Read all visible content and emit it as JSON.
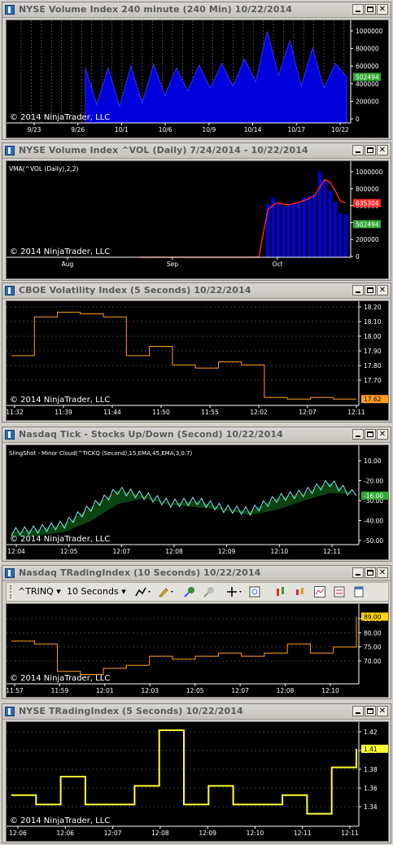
{
  "copyright": "© 2014 NinjaTrader, LLC",
  "colors": {
    "bg": "#000000",
    "grid": "#3a3a3a",
    "axis": "#ffffff",
    "volume": "#0000dd",
    "vma": "#ff2a2a",
    "orange": "#ff9e1f",
    "yellow": "#ffff33",
    "cyan": "#7ff0f0",
    "cloud_green": "#0e4a14",
    "cloud_red": "#5a1010",
    "swing_red": "#ff3030"
  },
  "window_buttons": {
    "min": "minimize",
    "max": "maximize",
    "close": "✕"
  },
  "toolbar": {
    "instrument": "^TRINQ",
    "interval": "10 Seconds",
    "icons": [
      "line-tool-icon",
      "pencil-icon",
      "zoom-in-icon",
      "zoom-out-icon",
      "crosshair-icon",
      "data-box-icon",
      "bar-style-icon",
      "candle-style-icon",
      "indicators-icon",
      "strategies-icon",
      "properties-icon"
    ]
  },
  "charts": [
    {
      "id": "vol240",
      "title": "NYSE Volume Index 240 minute (240 Min)  10/22/2014",
      "ytick_labels": [
        "1000000",
        "800000",
        "600000",
        "400000",
        "200000",
        "0"
      ],
      "xtick_labels": [
        "9/23",
        "9/26",
        "10/1",
        "10/6",
        "10/9",
        "10/14",
        "10/17",
        "10/22"
      ],
      "last_label": "502494"
    },
    {
      "id": "volDaily",
      "title": "NYSE Volume Index ^VOL (Daily)  7/24/2014 - 10/22/2014",
      "indicator": "VMA(^VOL (Daily),2,2)",
      "ytick_labels": [
        "1000000",
        "800000",
        "600000",
        "400000",
        "200000",
        "0"
      ],
      "xtick_labels": [
        "Aug",
        "Sep",
        "Oct"
      ],
      "last_labels": [
        "635304",
        "502494"
      ]
    },
    {
      "id": "vix",
      "title": "CBOE Volatility Index (5 Seconds)  10/22/2014",
      "ytick_labels": [
        "18.20",
        "18.10",
        "18.00",
        "17.90",
        "17.80",
        "17.70"
      ],
      "xtick_labels": [
        "11:32",
        "11:39",
        "11:44",
        "11:50",
        "11:55",
        "12:02",
        "12:07",
        "12:11"
      ],
      "last_label": "17.62"
    },
    {
      "id": "tick",
      "title": "Nasdaq Tick - Stocks Up/Down (Second)  10/22/2014",
      "indicator": "SlingShot -  Minor  Cloud(^TICKQ (Second),15,EMA,45,EMA,3,0.7)",
      "ytick_labels": [
        "10.00",
        "-20.00",
        "-30.00",
        "-40.00",
        "-50.00"
      ],
      "xtick_labels": [
        "12:04",
        "12:05",
        "12:07",
        "12:08",
        "12:09",
        "12:10",
        "12:11"
      ],
      "last_label": "-16.00"
    },
    {
      "id": "trinq",
      "title": "Nasdaq TRadingIndex (10 Seconds)  10/22/2014",
      "ytick_labels": [
        "85.00",
        "80.00",
        "75.00",
        "70.00"
      ],
      "xtick_labels": [
        "11:57",
        "11:59",
        "12:01",
        "12:03",
        "12:05",
        "12:07",
        "12:08",
        "12:10"
      ],
      "last_label": "89.00"
    },
    {
      "id": "trin",
      "title": "NYSE TRadingIndex (5 Seconds)  10/22/2014",
      "ytick_labels": [
        "1.42",
        "1.40",
        "1.38",
        "1.36",
        "1.34"
      ],
      "xtick_labels": [
        "12:06",
        "12:06",
        "12:07",
        "12:08",
        "12:09",
        "12:10",
        "12:11",
        "12:11"
      ],
      "last_label": "1.41"
    }
  ],
  "chart_data": [
    {
      "type": "area",
      "title": "NYSE Volume Index 240 minute (240 Min)  10/22/2014",
      "x": [
        "9/26",
        "",
        "",
        "",
        "10/1",
        "",
        "",
        "",
        "10/6",
        "",
        "",
        "",
        "10/9",
        "",
        "",
        "",
        "10/14",
        "",
        "",
        "",
        "10/17",
        "",
        "",
        "10/22"
      ],
      "series": [
        {
          "values": [
            600000,
            200000,
            600000,
            180000,
            620000,
            220000,
            640000,
            300000,
            600000,
            350000,
            630000,
            380000,
            650000,
            400000,
            700000,
            450000,
            1000000,
            520000,
            900000,
            400000,
            820000,
            380000,
            650000,
            502494
          ]
        }
      ],
      "ylim": [
        0,
        1050000
      ],
      "grid": false
    },
    {
      "type": "bar",
      "title": "NYSE Volume Index ^VOL (Daily)  7/24/2014 - 10/22/2014",
      "categories": [
        "10/1",
        "10/2",
        "10/3",
        "10/6",
        "10/7",
        "10/8",
        "10/9",
        "10/10",
        "10/13",
        "10/14",
        "10/15",
        "10/16",
        "10/17",
        "10/20",
        "10/21",
        "10/22"
      ],
      "series": [
        {
          "values": [
            620000,
            700000,
            630000,
            600000,
            620000,
            640000,
            650000,
            700000,
            720000,
            750000,
            1000000,
            900000,
            780000,
            650000,
            520000,
            502494
          ]
        },
        {
          "name": "VMA(^VOL (Daily),2,2)",
          "values": [
            560000,
            610000,
            640000,
            620000,
            615000,
            630000,
            645000,
            665000,
            690000,
            720000,
            820000,
            910000,
            880000,
            780000,
            660000,
            635304
          ]
        }
      ],
      "ylim": [
        0,
        1050000
      ]
    },
    {
      "type": "line",
      "title": "CBOE Volatility Index (5 Seconds)  10/22/2014",
      "x": [
        "11:32",
        "",
        "",
        "11:39",
        "",
        "11:44",
        "",
        "11:50",
        "",
        "11:55",
        "",
        "12:02",
        "",
        "12:07",
        "",
        "12:11"
      ],
      "series": [
        {
          "values": [
            17.9,
            18.15,
            18.18,
            18.17,
            18.15,
            17.9,
            17.96,
            17.84,
            17.82,
            17.86,
            17.84,
            17.63,
            17.62,
            17.63,
            17.62,
            17.62
          ]
        }
      ],
      "ylim": [
        17.6,
        18.22
      ]
    },
    {
      "type": "line",
      "title": "Nasdaq Tick - Stocks Up/Down (Second)  10/22/2014",
      "x": [
        "12:04",
        "",
        "12:05",
        "",
        "12:07",
        "",
        "12:08",
        "",
        "12:09",
        "",
        "12:10",
        "",
        "12:11",
        ""
      ],
      "series": [
        {
          "name": "SlingShot -  Minor  Cloud(^TICKQ (Second),15,EMA,45,EMA,3,0.7)",
          "values": [
            -44,
            -42,
            -38,
            -25,
            -12,
            -16,
            -22,
            -20,
            -26,
            -28,
            -18,
            -14,
            -6,
            -16
          ]
        }
      ],
      "ylim": [
        -50,
        14
      ]
    },
    {
      "type": "line",
      "title": "Nasdaq TRadingIndex (10 Seconds)  10/22/2014",
      "x": [
        "11:57",
        "",
        "11:59",
        "",
        "12:01",
        "",
        "12:03",
        "",
        "12:05",
        "",
        "12:07",
        "",
        "12:08",
        "",
        "12:10",
        ""
      ],
      "series": [
        {
          "values": [
            81,
            80,
            71,
            70,
            72,
            73,
            76,
            75,
            76,
            77,
            76,
            77,
            80,
            77,
            79,
            89
          ]
        }
      ],
      "ylim": [
        68,
        91
      ]
    },
    {
      "type": "line",
      "title": "NYSE TRadingIndex (5 Seconds)  10/22/2014",
      "x": [
        "12:06",
        "",
        "12:06",
        "",
        "12:07",
        "",
        "12:08",
        "",
        "12:09",
        "",
        "12:10",
        "",
        "12:11",
        "",
        "12:11"
      ],
      "series": [
        {
          "values": [
            1.36,
            1.35,
            1.38,
            1.35,
            1.35,
            1.37,
            1.43,
            1.35,
            1.37,
            1.35,
            1.35,
            1.36,
            1.34,
            1.39,
            1.41
          ]
        }
      ],
      "ylim": [
        1.33,
        1.43
      ]
    }
  ]
}
